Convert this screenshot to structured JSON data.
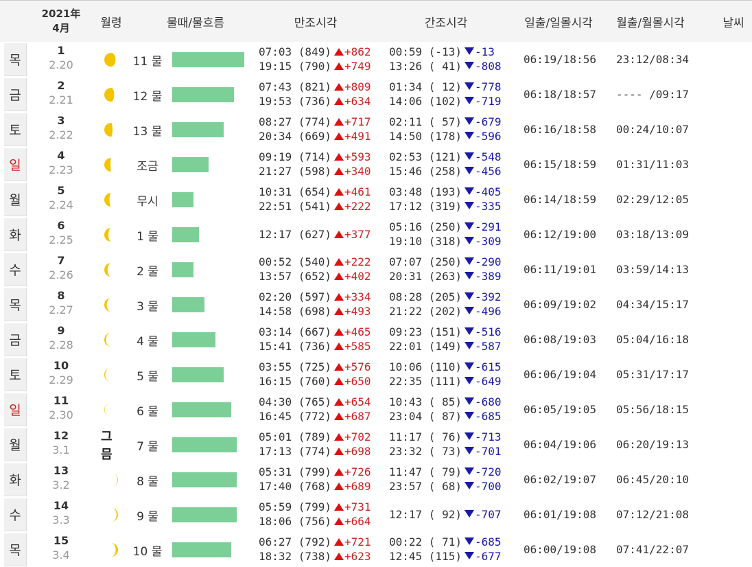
{
  "header": {
    "year": "2021年",
    "month": "4月",
    "moon_age": "월령",
    "tide": "물때/물흐름",
    "high_tide": "만조시각",
    "low_tide": "간조시각",
    "sun": "일출/일몰시각",
    "moon": "월출/월몰시각",
    "weather": "날씨"
  },
  "colors": {
    "bar": "#7ccf96",
    "rise": "#dd1111",
    "fall": "#1a1aa8",
    "moon": "#f5c400",
    "sunday": "#cc2222"
  },
  "rows": [
    {
      "dow": "목",
      "sunday": false,
      "day": "1",
      "lunar": "2.20",
      "moon_icon": "moon-waning-gibbous-icon",
      "moon_frac": 0.82,
      "moon_waxing": false,
      "tide": "11 물",
      "bar": 0.95,
      "high": [
        "07:03 (849)",
        "19:15 (790)"
      ],
      "high_diff": [
        "+862",
        "+749"
      ],
      "low": [
        "00:59 (-13)",
        "13:26 ( 41)"
      ],
      "low_diff": [
        "-13",
        "-808"
      ],
      "sun": "06:19/18:56",
      "moon": "23:12/08:34"
    },
    {
      "dow": "금",
      "sunday": false,
      "day": "2",
      "lunar": "2.21",
      "moon_icon": "moon-waning-gibbous-icon",
      "moon_frac": 0.72,
      "moon_waxing": false,
      "tide": "12 물",
      "bar": 0.82,
      "high": [
        "07:43 (821)",
        "19:53 (736)"
      ],
      "high_diff": [
        "+809",
        "+634"
      ],
      "low": [
        "01:34 ( 12)",
        "14:06 (102)"
      ],
      "low_diff": [
        "-778",
        "-719"
      ],
      "sun": "06:18/18:57",
      "moon": "---- /09:17"
    },
    {
      "dow": "토",
      "sunday": false,
      "day": "3",
      "lunar": "2.22",
      "moon_icon": "moon-last-quarter-icon",
      "moon_frac": 0.6,
      "moon_waxing": false,
      "tide": "13 물",
      "bar": 0.68,
      "high": [
        "08:27 (774)",
        "20:34 (669)"
      ],
      "high_diff": [
        "+717",
        "+491"
      ],
      "low": [
        "02:11 ( 57)",
        "14:50 (178)"
      ],
      "low_diff": [
        "-679",
        "-596"
      ],
      "sun": "06:16/18:58",
      "moon": "00:24/10:07"
    },
    {
      "dow": "일",
      "sunday": true,
      "day": "4",
      "lunar": "2.23",
      "moon_icon": "moon-waning-crescent-icon",
      "moon_frac": 0.45,
      "moon_waxing": false,
      "tide": "조금",
      "bar": 0.48,
      "high": [
        "09:19 (714)",
        "21:27 (598)"
      ],
      "high_diff": [
        "+593",
        "+340"
      ],
      "low": [
        "02:53 (121)",
        "15:46 (258)"
      ],
      "low_diff": [
        "-548",
        "-456"
      ],
      "sun": "06:15/18:59",
      "moon": "01:31/11:03"
    },
    {
      "dow": "월",
      "sunday": false,
      "day": "5",
      "lunar": "2.24",
      "moon_icon": "moon-waning-crescent-icon",
      "moon_frac": 0.38,
      "moon_waxing": false,
      "tide": "무시",
      "bar": 0.28,
      "high": [
        "10:31 (654)",
        "22:51 (541)"
      ],
      "high_diff": [
        "+461",
        "+222"
      ],
      "low": [
        "03:48 (193)",
        "17:12 (319)"
      ],
      "low_diff": [
        "-405",
        "-335"
      ],
      "sun": "06:14/18:59",
      "moon": "02:29/12:05"
    },
    {
      "dow": "화",
      "sunday": false,
      "day": "6",
      "lunar": "2.25",
      "moon_icon": "moon-waning-crescent-icon",
      "moon_frac": 0.3,
      "moon_waxing": false,
      "tide": "1 물",
      "bar": 0.35,
      "high": [
        "12:17 (627)"
      ],
      "high_diff": [
        "+377"
      ],
      "low": [
        "05:16 (250)",
        "19:10 (318)"
      ],
      "low_diff": [
        "-291",
        "-309"
      ],
      "sun": "06:12/19:00",
      "moon": "03:18/13:09"
    },
    {
      "dow": "수",
      "sunday": false,
      "day": "7",
      "lunar": "2.26",
      "moon_icon": "moon-waning-crescent-icon",
      "moon_frac": 0.24,
      "moon_waxing": false,
      "tide": "2 물",
      "bar": 0.28,
      "high": [
        "00:52 (540)",
        "13:57 (652)"
      ],
      "high_diff": [
        "+222",
        "+402"
      ],
      "low": [
        "07:07 (250)",
        "20:31 (263)"
      ],
      "low_diff": [
        "-290",
        "-389"
      ],
      "sun": "06:11/19:01",
      "moon": "03:59/14:13"
    },
    {
      "dow": "목",
      "sunday": false,
      "day": "8",
      "lunar": "2.27",
      "moon_icon": "moon-waning-crescent-icon",
      "moon_frac": 0.18,
      "moon_waxing": false,
      "tide": "3 물",
      "bar": 0.43,
      "high": [
        "02:20 (597)",
        "14:58 (698)"
      ],
      "high_diff": [
        "+334",
        "+493"
      ],
      "low": [
        "08:28 (205)",
        "21:22 (202)"
      ],
      "low_diff": [
        "-392",
        "-496"
      ],
      "sun": "06:09/19:02",
      "moon": "04:34/15:17"
    },
    {
      "dow": "금",
      "sunday": false,
      "day": "9",
      "lunar": "2.28",
      "moon_icon": "moon-waning-crescent-icon",
      "moon_frac": 0.12,
      "moon_waxing": false,
      "tide": "4 물",
      "bar": 0.57,
      "high": [
        "03:14 (667)",
        "15:41 (736)"
      ],
      "high_diff": [
        "+465",
        "+585"
      ],
      "low": [
        "09:23 (151)",
        "22:01 (149)"
      ],
      "low_diff": [
        "-516",
        "-587"
      ],
      "sun": "06:08/19:03",
      "moon": "05:04/16:18"
    },
    {
      "dow": "토",
      "sunday": false,
      "day": "10",
      "lunar": "2.29",
      "moon_icon": "moon-waning-crescent-icon",
      "moon_frac": 0.07,
      "moon_waxing": false,
      "tide": "5 물",
      "bar": 0.68,
      "high": [
        "03:55 (725)",
        "16:15 (760)"
      ],
      "high_diff": [
        "+576",
        "+650"
      ],
      "low": [
        "10:06 (110)",
        "22:35 (111)"
      ],
      "low_diff": [
        "-615",
        "-649"
      ],
      "sun": "06:06/19:04",
      "moon": "05:31/17:17"
    },
    {
      "dow": "일",
      "sunday": true,
      "day": "11",
      "lunar": "2.30",
      "moon_icon": "moon-waning-crescent-icon",
      "moon_frac": 0.03,
      "moon_waxing": false,
      "tide": "6 물",
      "bar": 0.78,
      "high": [
        "04:30 (765)",
        "16:45 (772)"
      ],
      "high_diff": [
        "+654",
        "+687"
      ],
      "low": [
        "10:43 ( 85)",
        "23:04 ( 87)"
      ],
      "low_diff": [
        "-680",
        "-685"
      ],
      "sun": "06:05/19:05",
      "moon": "05:56/18:15"
    },
    {
      "dow": "월",
      "sunday": false,
      "day": "12",
      "lunar": "3.1",
      "moon_icon": "",
      "moon_text": "그믐",
      "tide": "7 물",
      "bar": 0.85,
      "high": [
        "05:01 (789)",
        "17:13 (774)"
      ],
      "high_diff": [
        "+702",
        "+698"
      ],
      "low": [
        "11:17 ( 76)",
        "23:32 ( 73)"
      ],
      "low_diff": [
        "-713",
        "-701"
      ],
      "sun": "06:04/19:06",
      "moon": "06:20/19:13"
    },
    {
      "dow": "화",
      "sunday": false,
      "day": "13",
      "lunar": "3.2",
      "moon_icon": "moon-waxing-crescent-icon",
      "moon_frac": 0.04,
      "moon_waxing": true,
      "tide": "8 물",
      "bar": 0.85,
      "high": [
        "05:31 (799)",
        "17:40 (768)"
      ],
      "high_diff": [
        "+726",
        "+689"
      ],
      "low": [
        "11:47 ( 79)",
        "23:57 ( 68)"
      ],
      "low_diff": [
        "-720",
        "-700"
      ],
      "sun": "06:02/19:07",
      "moon": "06:45/20:10"
    },
    {
      "dow": "수",
      "sunday": false,
      "day": "14",
      "lunar": "3.3",
      "moon_icon": "moon-waxing-crescent-icon",
      "moon_frac": 0.1,
      "moon_waxing": true,
      "tide": "9 물",
      "bar": 0.85,
      "high": [
        "05:59 (799)",
        "18:06 (756)"
      ],
      "high_diff": [
        "+731",
        "+664"
      ],
      "low": [
        "12:17 ( 92)"
      ],
      "low_diff": [
        "-707"
      ],
      "sun": "06:01/19:08",
      "moon": "07:12/21:08"
    },
    {
      "dow": "목",
      "sunday": false,
      "day": "15",
      "lunar": "3.4",
      "moon_icon": "moon-waxing-crescent-icon",
      "moon_frac": 0.17,
      "moon_waxing": true,
      "tide": "10 물",
      "bar": 0.78,
      "high": [
        "06:27 (792)",
        "18:32 (738)"
      ],
      "high_diff": [
        "+721",
        "+623"
      ],
      "low": [
        "00:22 ( 71)",
        "12:45 (115)"
      ],
      "low_diff": [
        "-685",
        "-677"
      ],
      "sun": "06:00/19:08",
      "moon": "07:41/22:07"
    }
  ]
}
